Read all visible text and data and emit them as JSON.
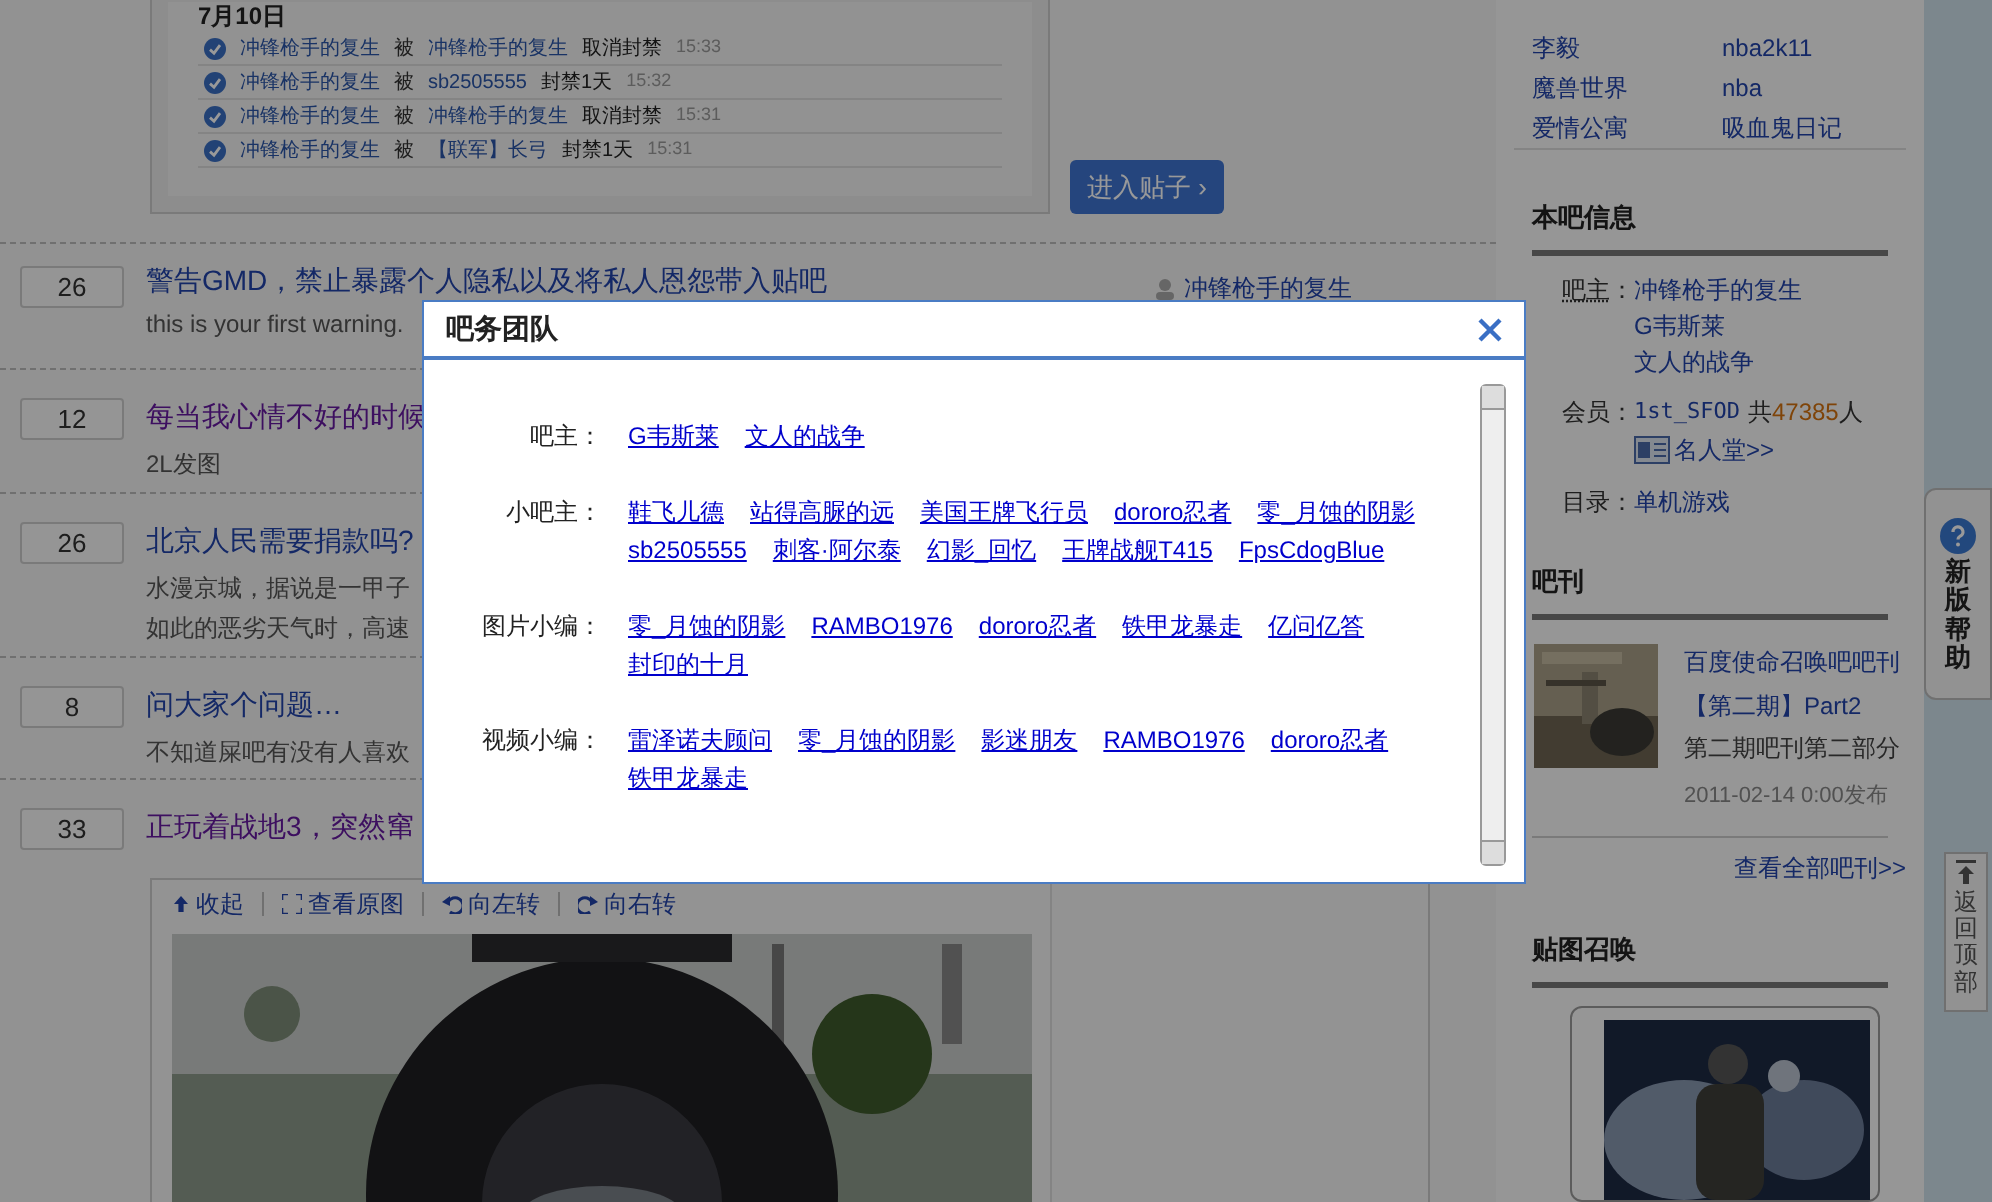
{
  "top_card": {
    "date_heading": "7月10日",
    "log_rows": [
      {
        "actor": "冲锋枪手的复生",
        "verb": "被",
        "target": "冲锋枪手的复生",
        "action": "取消封禁",
        "time": "15:33"
      },
      {
        "actor": "冲锋枪手的复生",
        "verb": "被",
        "target": "sb2505555",
        "action": "封禁1天",
        "time": "15:32"
      },
      {
        "actor": "冲锋枪手的复生",
        "verb": "被",
        "target": "冲锋枪手的复生",
        "action": "取消封禁",
        "time": "15:31"
      },
      {
        "actor": "冲锋枪手的复生",
        "verb": "被",
        "target": "【联军】长弓",
        "action": "封禁1天",
        "time": "15:31"
      }
    ]
  },
  "enter_button": "进入贴子 ›",
  "threads": [
    {
      "reply_count": "26",
      "title": "警告GMD，禁止暴露个人隐私以及将私人恩怨带入贴吧",
      "visited": false,
      "snippet": [
        "this is your first warning."
      ],
      "author": "冲锋枪手的复生"
    },
    {
      "reply_count": "12",
      "title": "每当我心情不好的时候",
      "visited": true,
      "snippet": [
        "2L发图"
      ]
    },
    {
      "reply_count": "26",
      "title": "北京人民需要捐款吗?",
      "visited": false,
      "snippet": [
        "水漫京城，据说是一甲子",
        "如此的恶劣天气时，高速"
      ]
    },
    {
      "reply_count": "8",
      "title": "问大家个问题…",
      "visited": false,
      "snippet": [
        "不知道屎吧有没有人喜欢"
      ]
    },
    {
      "reply_count": "33",
      "title": "正玩着战地3，突然窜",
      "visited": true
    }
  ],
  "image_toolbar": [
    {
      "kind": "collapse",
      "label": "收起"
    },
    {
      "kind": "full",
      "label": "查看原图"
    },
    {
      "kind": "left",
      "label": "向左转"
    },
    {
      "kind": "right",
      "label": "向右转"
    }
  ],
  "sidebar": {
    "favorites": [
      "李毅",
      "nba2k11",
      "魔兽世界",
      "nba",
      "爱情公寓",
      "吸血鬼日记"
    ],
    "info_title": "本吧信息",
    "owners_label": "吧主",
    "owners_colon": "：",
    "owners": [
      "冲锋枪手的复生",
      "G韦斯莱",
      "文人的战争"
    ],
    "members_label": "会员：",
    "member_name": "1st_SFOD",
    "member_total_prefix": "共",
    "member_count": "47385",
    "member_unit": "人",
    "hall": "名人堂>>",
    "directory_label": "目录：",
    "directory": "单机游戏",
    "magazine_title": "吧刊",
    "magazine_name": "百度使命召唤吧吧刊【第二期】Part2",
    "magazine_desc": "第二期吧刊第二部分",
    "magazine_date": "2011-02-14 0:00发布",
    "magazine_all": "查看全部吧刊>>",
    "picture_title": "贴图召唤"
  },
  "help_tab": "新版帮助",
  "back_to_top": "返回顶部",
  "dialog": {
    "title": "吧务团队",
    "groups": [
      {
        "label": "吧主：",
        "members": [
          "G韦斯莱",
          "文人的战争"
        ]
      },
      {
        "label": "小吧主：",
        "members": [
          "鞋飞儿德",
          "站得高脲的远",
          "美国王牌飞行员",
          "dororo忍者",
          "零_月蚀的阴影",
          "sb2505555",
          "刺客·阿尔泰",
          "幻影_回忆",
          "王牌战舰T415",
          "FpsCdogBlue"
        ]
      },
      {
        "label": "图片小编：",
        "members": [
          "零_月蚀的阴影",
          "RAMBO1976",
          "dororo忍者",
          "铁甲龙暴走",
          "亿问亿答",
          "封印的十月"
        ]
      },
      {
        "label": "视频小编：",
        "members": [
          "雷泽诺夫顾问",
          "零_月蚀的阴影",
          "影迷朋友",
          "RAMBO1976",
          "dororo忍者",
          "铁甲龙暴走"
        ]
      }
    ]
  }
}
